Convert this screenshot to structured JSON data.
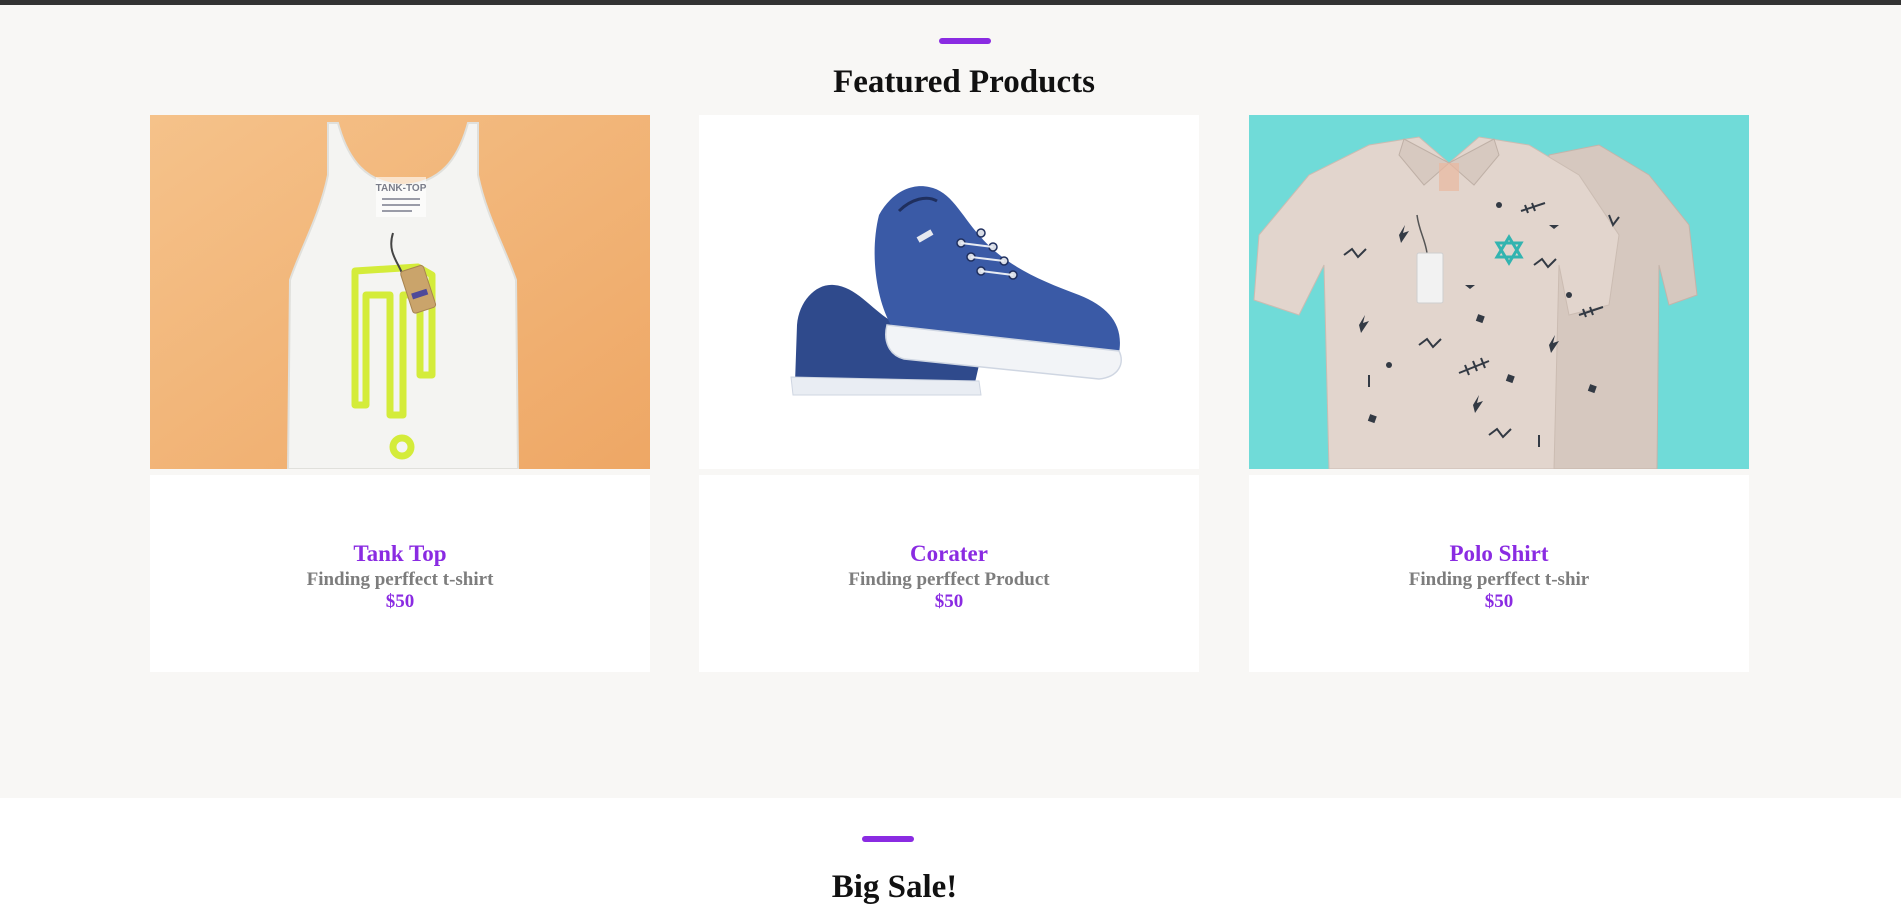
{
  "featured": {
    "title": "Featured Products",
    "accent_color": "#8a2be2",
    "products": [
      {
        "name": "Tank Top",
        "description": "Finding perffect t-shirt",
        "price": "$50",
        "image_icon": "tank-top-image",
        "tag_text": "TANK-TOP"
      },
      {
        "name": "Corater",
        "description": "Finding perffect Product",
        "price": "$50",
        "image_icon": "sneakers-image"
      },
      {
        "name": "Polo Shirt",
        "description": "Finding perffect t-shir",
        "price": "$50",
        "image_icon": "polo-shirt-image"
      }
    ]
  },
  "sale": {
    "title": "Big Sale!"
  }
}
